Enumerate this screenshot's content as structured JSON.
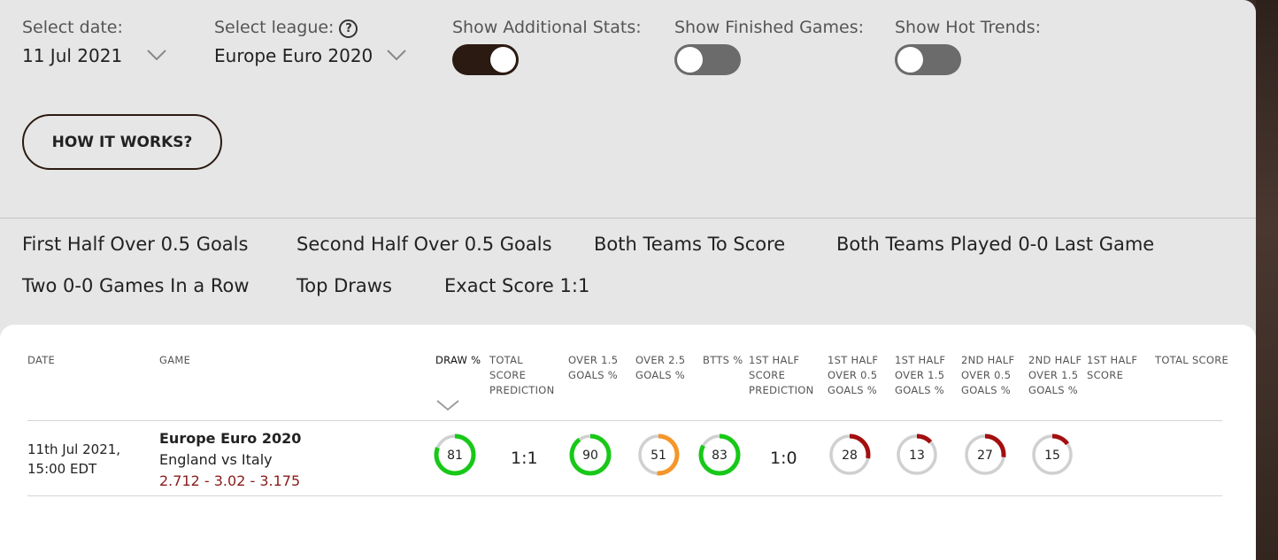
{
  "filters": {
    "date_label": "Select date:",
    "date_value": "11 Jul 2021",
    "league_label": "Select league:",
    "league_value": "Europe Euro 2020",
    "help_glyph": "?",
    "additional_stats_label": "Show Additional Stats:",
    "additional_stats_on": true,
    "finished_games_label": "Show Finished Games:",
    "finished_games_on": false,
    "hot_trends_label": "Show Hot Trends:",
    "hot_trends_on": false
  },
  "how_it_works_label": "HOW IT WORKS?",
  "trends": [
    "First Half Over 0.5 Goals",
    "Second Half Over 0.5 Goals",
    "Both Teams To Score",
    "Both Teams Played 0-0 Last Game",
    "Two 0-0 Games In a Row",
    "Top Draws",
    "Exact Score 1:1"
  ],
  "table": {
    "headers": {
      "date": "DATE",
      "game": "GAME",
      "draw": "DRAW %",
      "total_pred": [
        "TOTAL",
        "SCORE",
        "PREDICTION"
      ],
      "over15": [
        "OVER 1.5",
        "GOALS %"
      ],
      "over25": [
        "OVER 2.5",
        "GOALS %"
      ],
      "btts": "BTTS %",
      "half_pred": [
        "1ST HALF",
        "SCORE",
        "PREDICTION"
      ],
      "h1_over05": [
        "1ST HALF",
        "OVER 0.5",
        "GOALS %"
      ],
      "h1_over15": [
        "1ST HALF",
        "OVER 1.5",
        "GOALS %"
      ],
      "h2_over05": [
        "2ND HALF",
        "OVER 0.5",
        "GOALS %"
      ],
      "h2_over15": [
        "2ND HALF",
        "OVER 1.5",
        "GOALS %"
      ],
      "h1_score": [
        "1ST HALF",
        "SCORE"
      ],
      "total_score": "TOTAL SCORE"
    },
    "rows": [
      {
        "date_line1": "11th Jul 2021,",
        "date_line2": "15:00 EDT",
        "league": "Europe Euro 2020",
        "teams": "England vs Italy",
        "odds": "2.712 - 3.02 - 3.175",
        "draw_pct": 81,
        "total_score_prediction": "1:1",
        "over15_pct": 90,
        "over25_pct": 51,
        "btts_pct": 83,
        "half_score_prediction": "1:0",
        "h1_over05_pct": 28,
        "h1_over15_pct": 13,
        "h2_over05_pct": 27,
        "h2_over15_pct": 15,
        "h1_score": "",
        "total_score": ""
      }
    ]
  },
  "colors": {
    "green": "#18c818",
    "orange": "#f5962a",
    "red": "#a30f0f",
    "track": "#d0d0d0",
    "odds": "#8b1a1a",
    "toggle_on": "#2b1a12",
    "toggle_off": "#6b6b6b"
  }
}
